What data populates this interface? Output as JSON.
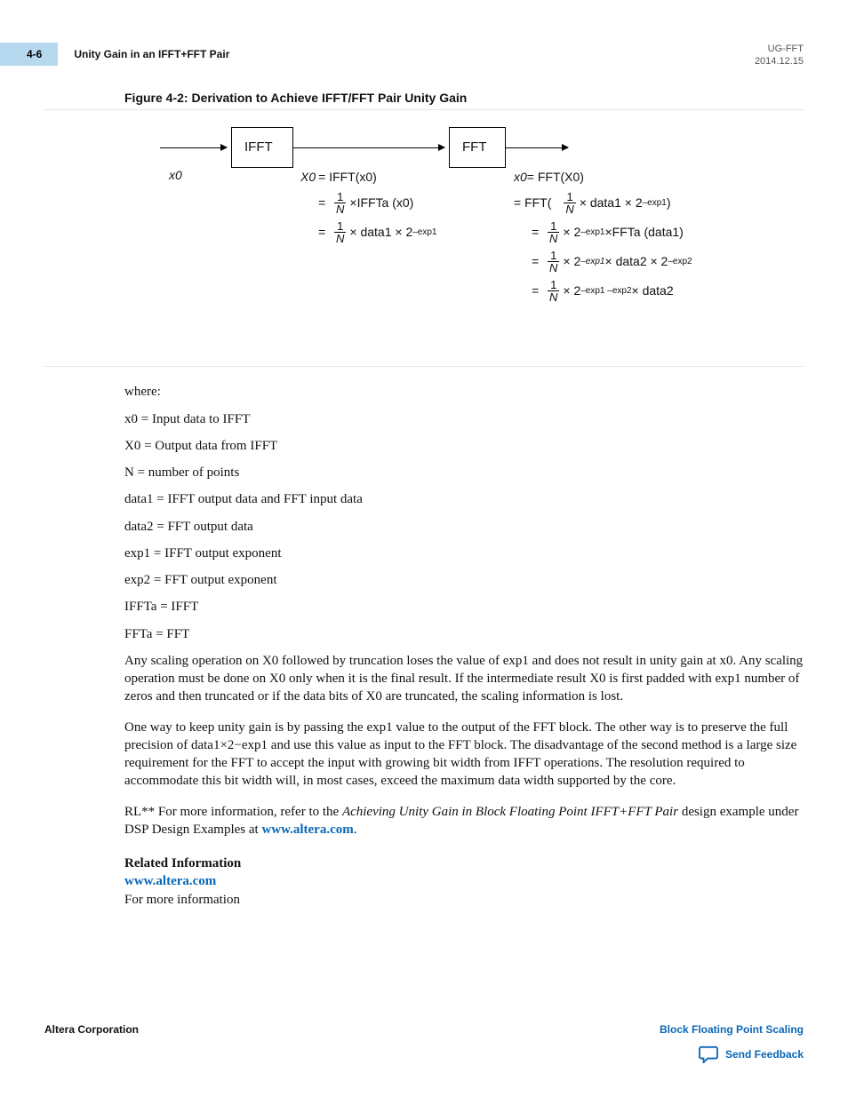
{
  "header": {
    "page_number": "4-6",
    "section_title": "Unity Gain in an IFFT+FFT Pair",
    "doc_id": "UG-FFT",
    "date": "2014.12.15"
  },
  "figure": {
    "caption": "Figure 4-2: Derivation to Achieve IFFT/FFT Pair Unity Gain",
    "box_ifft": "IFFT",
    "box_fft": "FFT",
    "label_x0_in": "x0",
    "ifft_eq": {
      "line1_lhs": "X0",
      "line1_rhs": "= IFFT(x0)",
      "line2": "×IFFTa   (x0)",
      "line3": "× data1 × 2",
      "line3_exp": "–exp1"
    },
    "fft_eq": {
      "line1_lhs": "x0",
      "line1_rhs": " = FFT(X0)",
      "line2_pre": "= FFT(",
      "line2_mid": "× data1 × 2",
      "line2_exp": "–exp1",
      "line2_post": ")",
      "line3_mid": "× 2",
      "line3_exp": "–exp1",
      "line3_post": "×FFTa   (data1)",
      "line4_mid": "× 2",
      "line4_exp1": "–exp1",
      "line4_post": "× data2 × 2",
      "line4_exp2": "–exp2",
      "line5_mid": "× 2",
      "line5_exp": "–exp1 –exp2",
      "line5_post": "× data2"
    }
  },
  "definitions": {
    "where": "where:",
    "d1": "x0 = Input data to IFFT",
    "d2": "X0 = Output data from IFFT",
    "d3": "N = number of points",
    "d4": "data1 = IFFT output data and FFT input data",
    "d5": "data2 = FFT output data",
    "d6": "exp1 = IFFT output exponent",
    "d7": "exp2 = FFT output exponent",
    "d8": "IFFTa = IFFT",
    "d9": "FFTa = FFT"
  },
  "paragraphs": {
    "p1": "Any scaling operation on X0 followed by truncation loses the value of exp1 and does not result in unity gain at x0. Any scaling operation must be done on X0 only when it is the final result. If the intermediate result X0 is first padded with exp1 number of zeros and then truncated or if the data bits of X0 are truncated, the scaling information is lost.",
    "p2": "One way to keep unity gain is by passing the exp1 value to the output of the FFT block. The other way is to preserve the full precision of data1×2−exp1 and use this value as input to the FFT block. The disadvantage of the second method is a large size requirement for the FFT to accept the input with growing bit width from IFFT operations. The resolution required to accommodate this bit width will, in most cases, exceed the maximum data width supported by the core.",
    "p3_pre": "RL** For more information, refer to the ",
    "p3_ital": "Achieving Unity Gain in Block Floating Point IFFT+FFT Pair",
    "p3_post": " design example under DSP Design Examples at ",
    "p3_link": "www.altera.com",
    "p3_end": "."
  },
  "related": {
    "heading": "Related Information",
    "link": "www.altera.com",
    "sub": "For more information"
  },
  "footer": {
    "corp": "Altera Corporation",
    "chapter_link": "Block Floating Point Scaling",
    "feedback": "Send Feedback"
  }
}
